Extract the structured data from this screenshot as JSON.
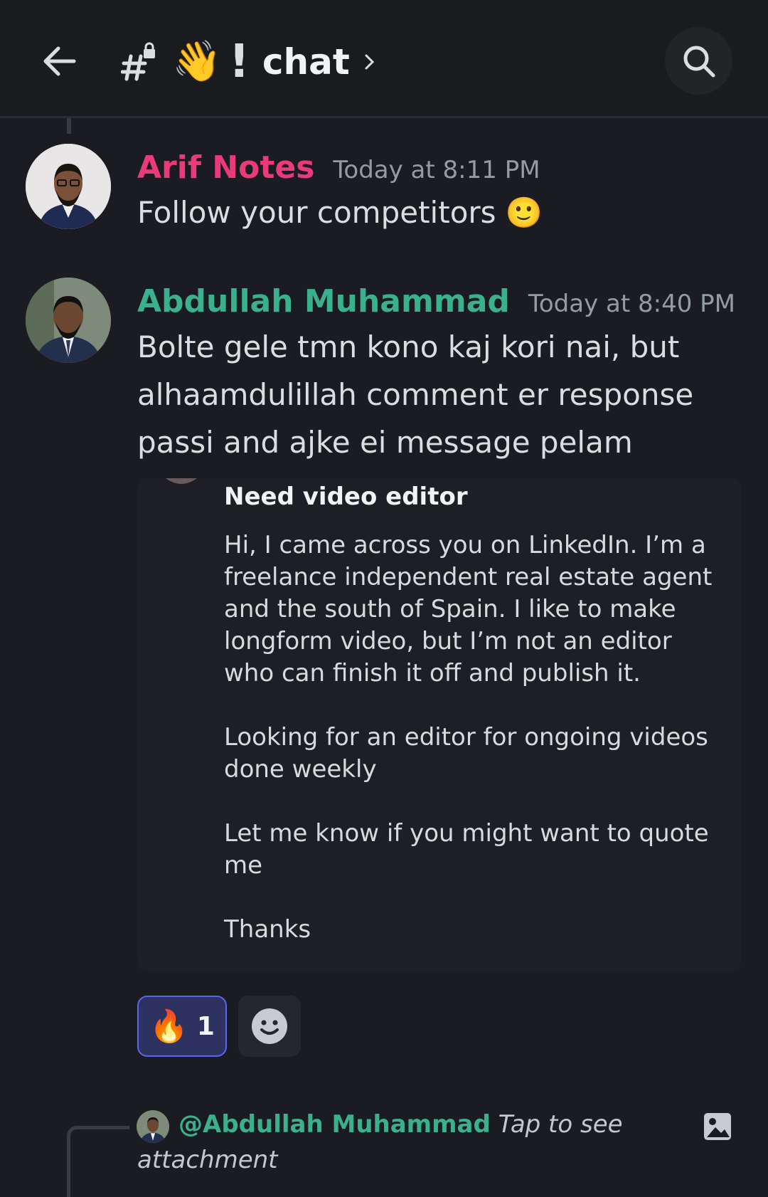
{
  "header": {
    "channel_name": "chat",
    "wave_emoji": "👋",
    "exclamation": "!",
    "icons": [
      "back-arrow-icon",
      "locked-hash-icon",
      "chevron-right-icon",
      "search-icon"
    ]
  },
  "messages": [
    {
      "author": "Arif Notes",
      "author_color": "#eb3a7a",
      "time": "Today at 8:11 PM",
      "text": "Follow your competitors 🙂"
    },
    {
      "author": "Abdullah Muhammad",
      "author_color": "#3ab08c",
      "time": "Today at 8:40 PM",
      "text": "Bolte gele tmn kono kaj kori nai, but alhaamdulillah comment er response passi and ajke ei message pelam"
    }
  ],
  "embed": {
    "title": "Need video editor",
    "body": "Hi, I came across you on LinkedIn. I’m a freelance independent real estate agent and the south of Spain. I like to make longform video, but I’m not an editor who can finish it off and publish it.\n\nLooking for an editor for ongoing videos done weekly\n\nLet me know if you might want to quote me\n\nThanks"
  },
  "reactions": {
    "fire_emoji": "🔥",
    "fire_count": "1",
    "add_icon": "add-reaction-icon"
  },
  "reply": {
    "mention": "@Abdullah Muhammad",
    "text": "Tap to see attachment",
    "icon": "image-icon"
  },
  "colors": {
    "background": "#1b1c21",
    "accent": "#5865f2"
  }
}
